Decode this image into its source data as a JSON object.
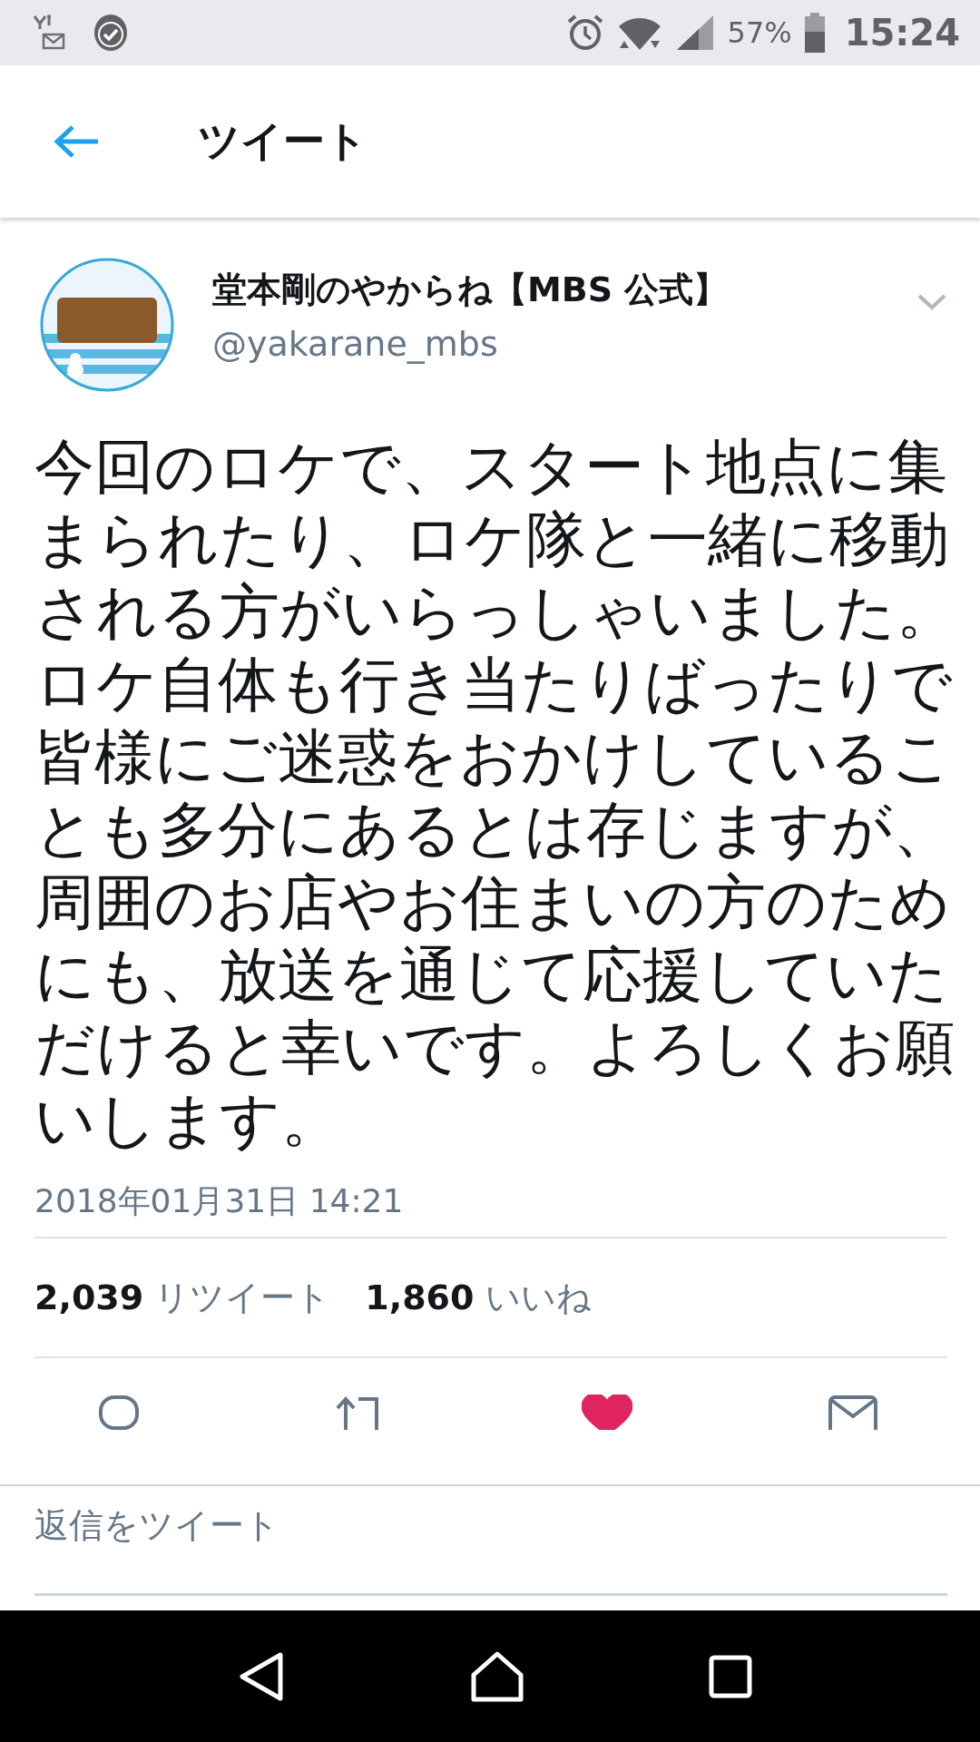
{
  "status_bar": {
    "battery": "57%",
    "time": "15:24"
  },
  "header": {
    "title": "ツイート"
  },
  "tweet": {
    "display_name": "堂本剛のやからね【MBS 公式】",
    "handle": "@yakarane_mbs",
    "text": "今回のロケで、スタート地点に集まられたり、ロケ隊と一緒に移動される方がいらっしゃいました。ロケ自体も行き当たりばったりで皆様にご迷惑をおかけしていることも多分にあるとは存じますが、周囲のお店やお住まいの方のためにも、放送を通じて応援していただけると幸いです。よろしくお願いします。",
    "timestamp": "2018年01月31日 14:21"
  },
  "stats": [
    {
      "count": "2,039",
      "label": "リツイート"
    },
    {
      "count": "1,860",
      "label": "いいね"
    }
  ],
  "actions": [
    {
      "kind": "reply",
      "active": false
    },
    {
      "kind": "retweet",
      "active": false
    },
    {
      "kind": "like",
      "active": true
    },
    {
      "kind": "message",
      "active": false
    }
  ],
  "reply": {
    "placeholder": "返信をツイート"
  }
}
